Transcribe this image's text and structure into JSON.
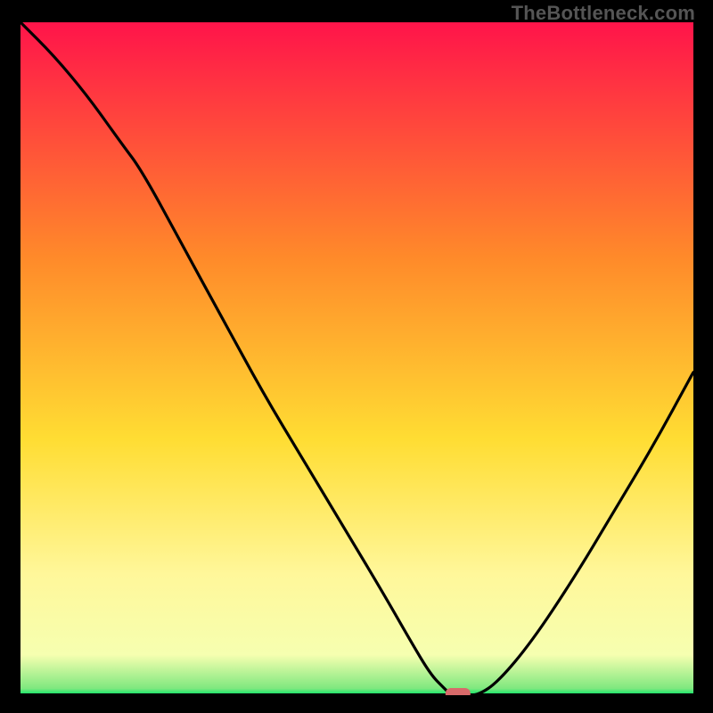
{
  "watermark": "TheBottleneck.com",
  "colors": {
    "bg_black": "#000000",
    "watermark_text": "#555555",
    "curve": "#000000",
    "marker": "#d86a6a",
    "axis": "#000000",
    "gradient": {
      "top": "#ff144a",
      "mid1": "#ff8a2a",
      "mid2": "#ffdd33",
      "mid3": "#fff79a",
      "bottom_band": "#f6ffb0",
      "baseline": "#00e565"
    }
  },
  "chart_data": {
    "type": "line",
    "title": "",
    "xlabel": "",
    "ylabel": "",
    "xlim": [
      0,
      100
    ],
    "ylim": [
      0,
      100
    ],
    "grid": false,
    "legend": false,
    "series": [
      {
        "name": "bottleneck-curve",
        "x": [
          0,
          5,
          10,
          15,
          18,
          24,
          30,
          36,
          42,
          48,
          54,
          58,
          61,
          63,
          64,
          66,
          68,
          71,
          76,
          82,
          88,
          94,
          100
        ],
        "y": [
          100,
          95,
          89,
          82,
          78,
          67,
          56,
          45,
          35,
          25,
          15,
          8,
          3,
          1,
          0,
          0,
          0,
          2,
          8,
          17,
          27,
          37,
          48
        ]
      }
    ],
    "marker": {
      "x": 65,
      "y": 0,
      "shape": "rounded-pill"
    }
  }
}
